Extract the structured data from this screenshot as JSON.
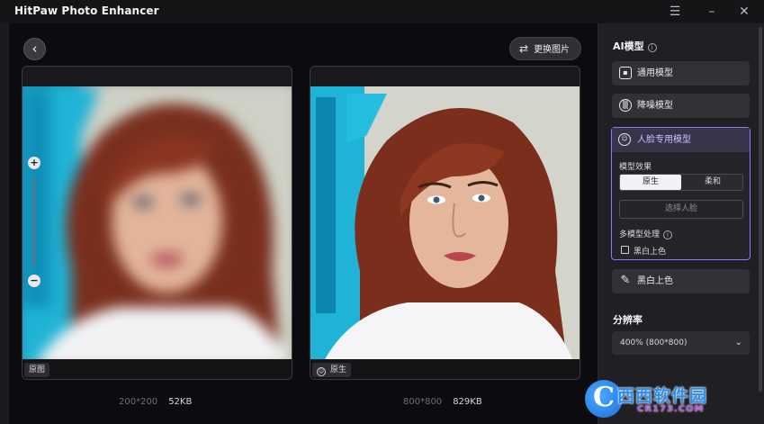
{
  "app": {
    "title": "HitPaw Photo Enhancer"
  },
  "toolbar": {
    "replace_label": "更换图片"
  },
  "preview": {
    "original_tag": "原图",
    "enhanced_tag": "原生",
    "original_resolution": "200*200",
    "original_size": "52KB",
    "enhanced_resolution": "800*800",
    "enhanced_size": "829KB"
  },
  "sidebar": {
    "ai_model_title": "AI模型",
    "models": [
      {
        "label": "通用模型",
        "icon": "image-icon"
      },
      {
        "label": "降噪模型",
        "icon": "denoise-icon"
      },
      {
        "label": "人脸专用模型",
        "icon": "face-icon"
      },
      {
        "label": "黑白上色",
        "icon": "brush-icon"
      }
    ],
    "face_model": {
      "effect_label": "模型效果",
      "effect_options": [
        "原生",
        "柔和"
      ],
      "effect_selected": "原生",
      "select_face": "选择人脸",
      "multi_label": "多模型处理",
      "colorize_checkbox": "黑白上色",
      "colorize_checked": false
    },
    "resolution_title": "分辨率",
    "resolution_value": "400% (800*800)"
  },
  "watermark": {
    "name": "西西软件园",
    "url": "CR173.COM"
  },
  "colors": {
    "accent": "#8d7bff",
    "panel": "#1f1f24",
    "background": "#0c0c10"
  }
}
